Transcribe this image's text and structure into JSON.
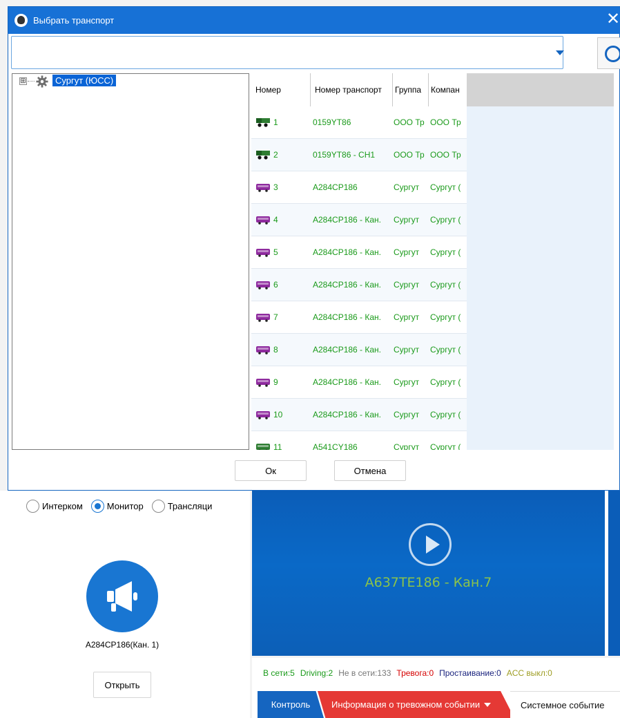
{
  "dialog": {
    "title": "Выбрать транспорт",
    "close_glyph": "✕",
    "search_value": "",
    "ok_label": "Ок",
    "cancel_label": "Отмена"
  },
  "tree": {
    "expander": "⊞",
    "root_label": "Сургут (ЮСС)"
  },
  "table": {
    "headers": [
      "Номер",
      "Номер транспорт",
      "Группа",
      "Компан"
    ],
    "rows": [
      {
        "num": "1",
        "transport": "0159YT86",
        "group": "ООО Тр",
        "company": "ООО Тр",
        "vehicle": "truck-icon",
        "color": "#2e7d32"
      },
      {
        "num": "2",
        "transport": "0159YT86 - CH1",
        "group": "ООО Тр",
        "company": "ООО Тр",
        "vehicle": "truck-icon",
        "color": "#2e7d32"
      },
      {
        "num": "3",
        "transport": "A284CP186",
        "group": "Сургут",
        "company": "Сургут (",
        "vehicle": "bus-icon",
        "color": "#8e2a9e"
      },
      {
        "num": "4",
        "transport": "A284CP186 - Кан.",
        "group": "Сургут",
        "company": "Сургут (",
        "vehicle": "bus-icon",
        "color": "#8e2a9e"
      },
      {
        "num": "5",
        "transport": "A284CP186 - Кан.",
        "group": "Сургут",
        "company": "Сургут (",
        "vehicle": "bus-icon",
        "color": "#8e2a9e"
      },
      {
        "num": "6",
        "transport": "A284CP186 - Кан.",
        "group": "Сургут",
        "company": "Сургут (",
        "vehicle": "bus-icon",
        "color": "#8e2a9e"
      },
      {
        "num": "7",
        "transport": "A284CP186 - Кан.",
        "group": "Сургут",
        "company": "Сургут (",
        "vehicle": "bus-icon",
        "color": "#8e2a9e"
      },
      {
        "num": "8",
        "transport": "A284CP186 - Кан.",
        "group": "Сургут",
        "company": "Сургут (",
        "vehicle": "bus-icon",
        "color": "#8e2a9e"
      },
      {
        "num": "9",
        "transport": "A284CP186 - Кан.",
        "group": "Сургут",
        "company": "Сургут (",
        "vehicle": "bus-icon",
        "color": "#8e2a9e"
      },
      {
        "num": "10",
        "transport": "A284CP186 - Кан.",
        "group": "Сургут",
        "company": "Сургут (",
        "vehicle": "bus-icon",
        "color": "#8e2a9e"
      },
      {
        "num": "11",
        "transport": "A541CY186",
        "group": "Сургут",
        "company": "Сургут (",
        "vehicle": "bus-icon",
        "color": "#2e7d32"
      }
    ]
  },
  "background": {
    "radio_options": [
      "Интерком",
      "Монитор",
      "Трансляци"
    ],
    "radio_selected": "Монитор",
    "speaker_caption": "A284CP186(Кан. 1)",
    "open_label": "Открыть",
    "video_channel_label": "A637TE186 - Кан.7",
    "status": {
      "online": "В сети:5",
      "driving": "Driving:2",
      "offline": "Не в сети:133",
      "alarm": "Тревога:0",
      "idle": "Простаивание:0",
      "acc_off": "ACC выкл:0"
    },
    "tabs": {
      "control": "Контроль",
      "alarm_info": "Информация о тревожном событии",
      "system_event": "Системное событие"
    }
  },
  "colors": {
    "title_bar": "#1771d6",
    "row_text_green": "#1a9a1a",
    "status_online": "#1a9a1a",
    "status_offline": "#777777",
    "status_alarm": "#d50000",
    "status_idle": "#1a237e",
    "status_acc": "#9e9d24",
    "tab_control": "#1565c0",
    "tab_alarm": "#e53935"
  }
}
